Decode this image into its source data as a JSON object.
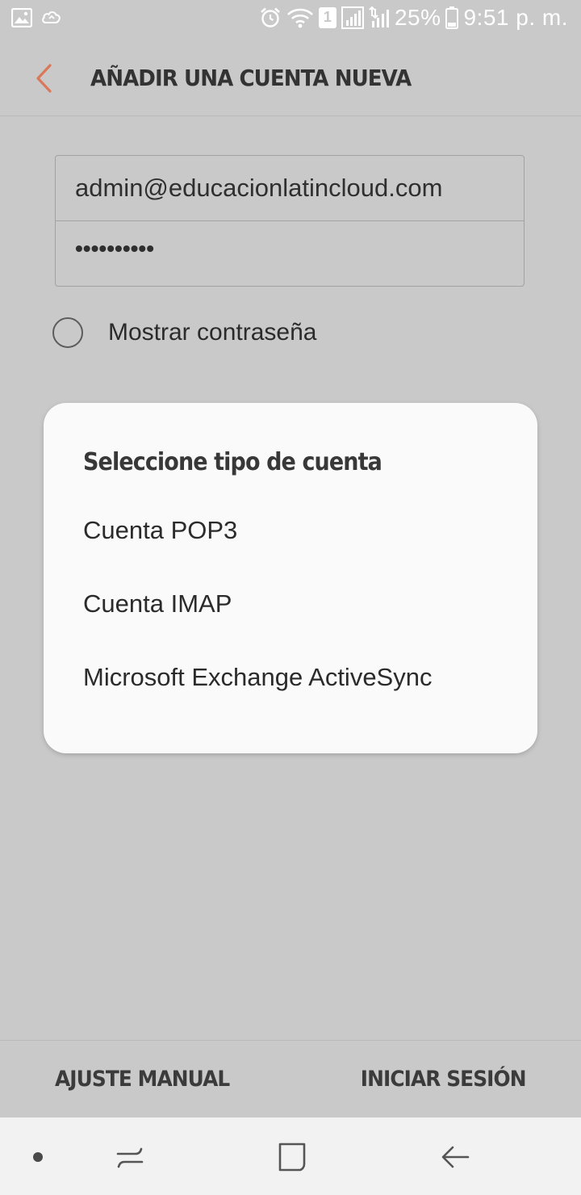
{
  "status_bar": {
    "left_icons": [
      "gallery-icon",
      "cloud-sync-icon"
    ],
    "right_icons": [
      "alarm-icon",
      "wifi-icon",
      "sim-1-icon",
      "signal-icon",
      "signal-2-icon",
      "battery-icon"
    ],
    "sim_label": "1",
    "battery": "25%",
    "time": "9:51 p. m."
  },
  "header": {
    "title": "AÑADIR UNA CUENTA NUEVA",
    "back_color": "#d9795a"
  },
  "form": {
    "email_value": "admin@educacionlatincloud.com",
    "password_value": "••••••••••",
    "show_password_label": "Mostrar contraseña",
    "show_password_checked": false
  },
  "dialog": {
    "title": "Seleccione tipo de cuenta",
    "options": [
      {
        "label": "Cuenta POP3"
      },
      {
        "label": "Cuenta IMAP"
      },
      {
        "label": "Microsoft Exchange ActiveSync"
      }
    ]
  },
  "actions": {
    "manual_label": "AJUSTE MANUAL",
    "login_label": "INICIAR SESIÓN"
  },
  "nav": {
    "icons": [
      "dot-icon",
      "recents-icon",
      "home-icon",
      "back-icon"
    ]
  }
}
